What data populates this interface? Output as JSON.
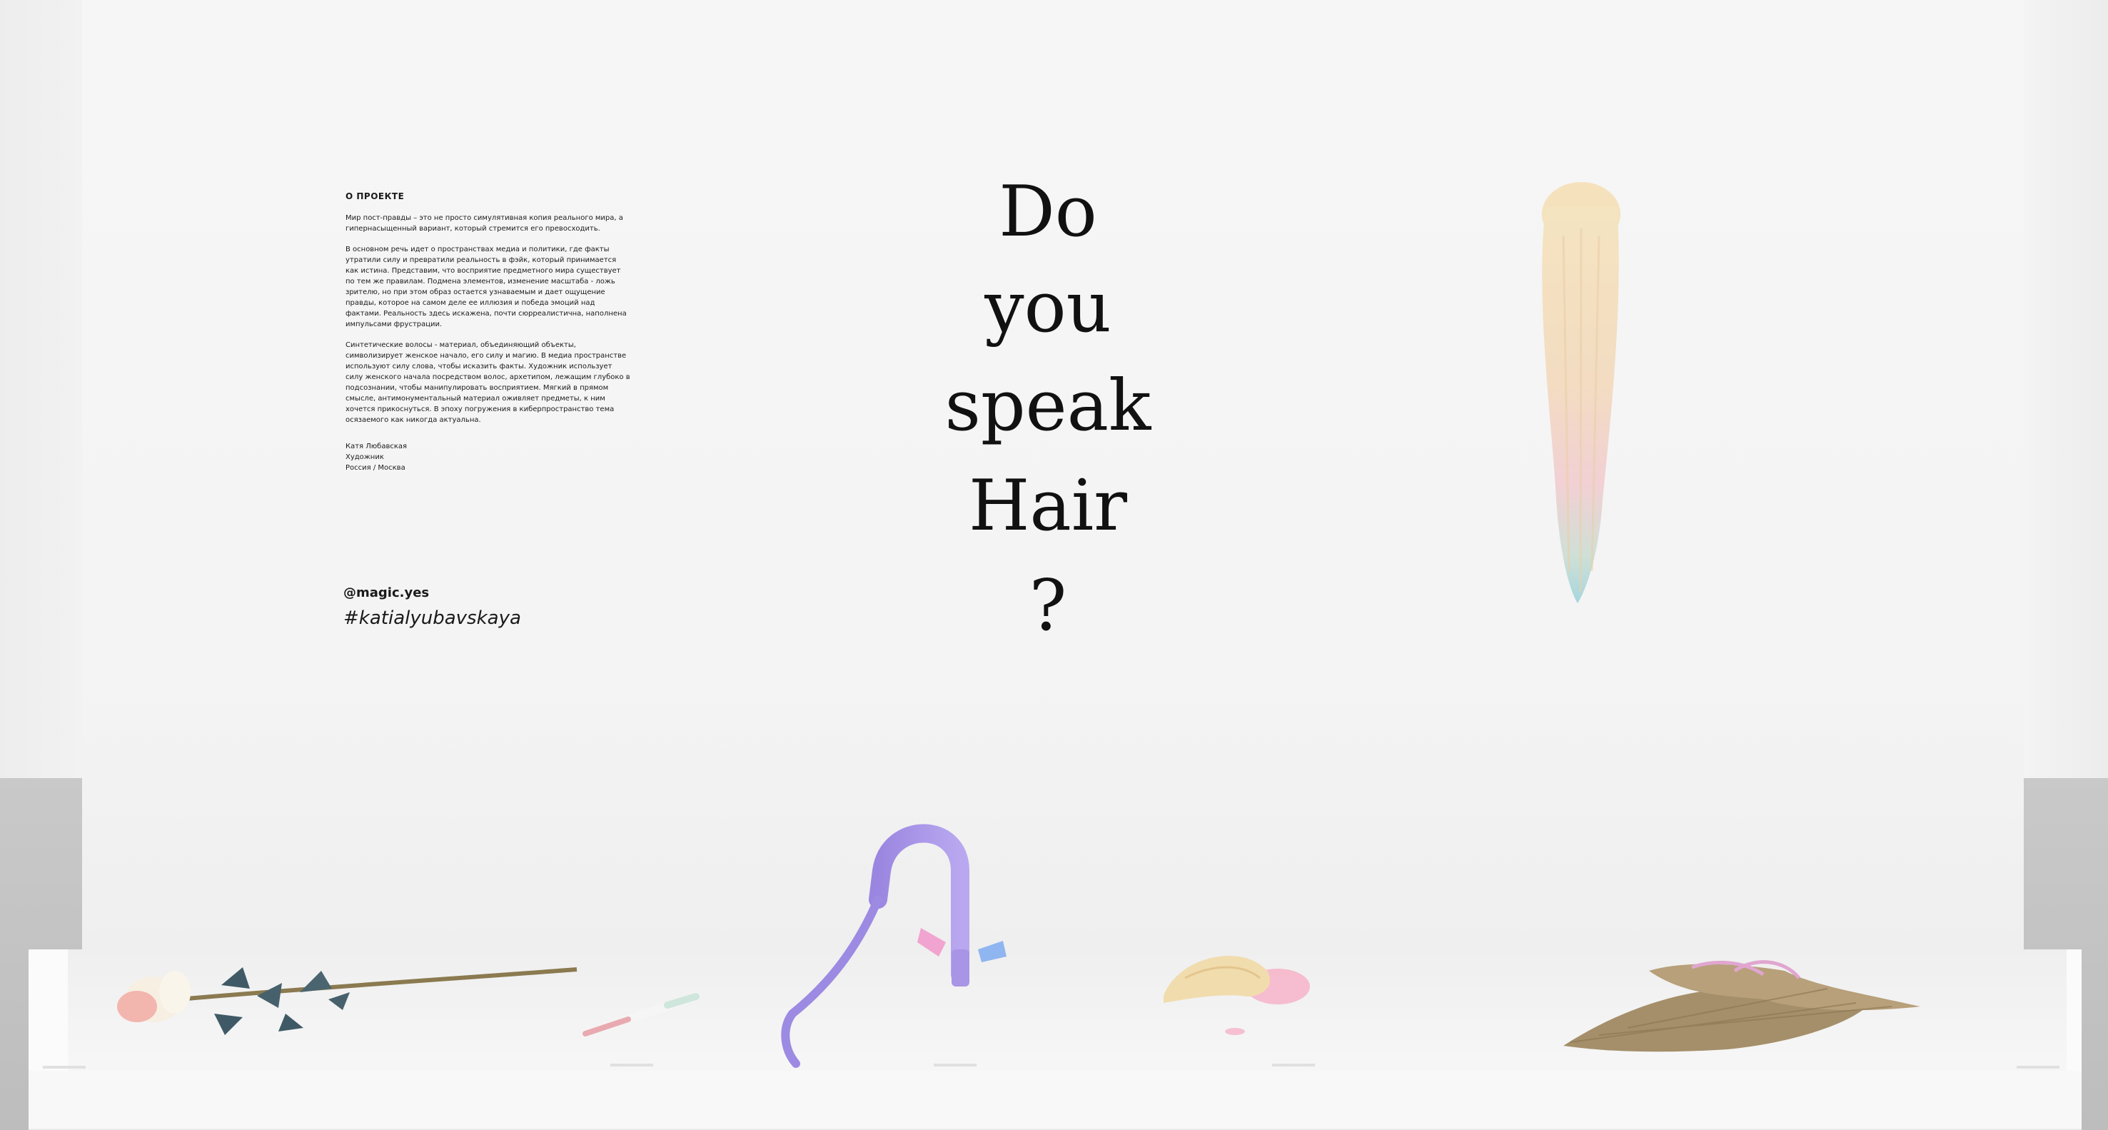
{
  "info": {
    "heading": "О ПРОЕКТЕ",
    "paragraph_1": "Мир пост-правды – это не просто симулятивная копия реального мира, а гипернасыщенный вариант, который стремится его превосходить.",
    "paragraph_2": "В основном речь идет о пространствах медиа и политики, где факты утратили силу и превратили реальность в фэйк, который принимается как истина. Представим, что восприятие предметного мира существует по тем же правилам. Подмена элементов, изменение масштаба - ложь зрителю, но при этом образ остается узнаваемым и дает ощущение правды, которое на самом деле ее иллюзия и победа эмоций над фактами. Реальность здесь искажена, почти сюрреалистична, наполнена импульсами фрустрации.",
    "paragraph_3": "Синтетические волосы - материал, объединяющий объекты, символизирует женское начало, его силу и магию. В медиа пространстве используют силу слова, чтобы исказить факты. Художник использует силу женского начала посредством волос, архетипом, лежащим глубоко в подсознании, чтобы манипулировать восприятием. Мягкий в прямом смысле, антимонументальный материал оживляет предметы, к ним хочется прикоснуться. В эпоху погружения в киберпространство тема осязаемого как никогда актуальна.",
    "artist_name": "Катя Любавская",
    "artist_role": "Художник",
    "artist_location": "Россия / Москва",
    "handle": "@magic.yes",
    "hashtag": "#katialyubavskaya"
  },
  "title": {
    "line_1": "Do",
    "line_2": "you",
    "line_3": "speak",
    "line_4": "Hair",
    "line_5": "?"
  },
  "colors": {
    "wall": "#f4f4f4",
    "floor": "#c4c4c4",
    "text": "#111111",
    "wig_blonde": "#f1dcae",
    "wig_pastel_pink": "#f3cfd5",
    "wig_pastel_blue": "#a9d8df",
    "faucet_lilac": "#a895e6",
    "rose_pink": "#f2b6ae",
    "leaf_blue": "#3f5a66",
    "stain_pink": "#f7a9c3",
    "hair_mixed": "#a48f6a"
  },
  "objects": [
    "pastel-ponytail-wig",
    "hair-rose",
    "hair-toothbrush",
    "hair-faucet",
    "wig-with-pink-stain",
    "hair-extension-pile"
  ]
}
